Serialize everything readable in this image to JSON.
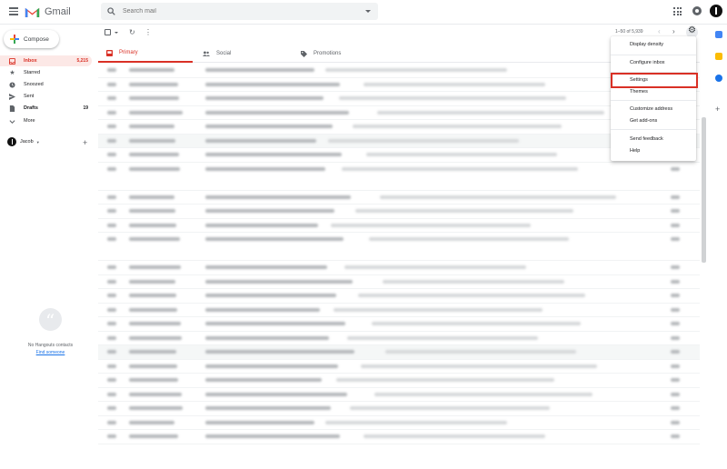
{
  "header": {
    "app_name": "Gmail",
    "search_placeholder": "Search mail"
  },
  "sidebar": {
    "compose_label": "Compose",
    "items": [
      {
        "label": "Inbox",
        "count": "5,215",
        "icon": "inbox-icon",
        "active": true
      },
      {
        "label": "Starred",
        "count": "",
        "icon": "star-icon"
      },
      {
        "label": "Snoozed",
        "count": "",
        "icon": "clock-icon"
      },
      {
        "label": "Sent",
        "count": "",
        "icon": "send-icon"
      },
      {
        "label": "Drafts",
        "count": "19",
        "icon": "draft-icon"
      },
      {
        "label": "More",
        "count": "",
        "icon": "chevron-down-icon"
      }
    ],
    "user_name": "Jacob",
    "hangouts_empty": "No Hangouts contacts",
    "hangouts_link": "Find someone"
  },
  "toolbar": {
    "pager_text": "1–50 of 5,939"
  },
  "tabs": [
    {
      "label": "Primary",
      "icon": "inbox-icon"
    },
    {
      "label": "Social",
      "icon": "people-icon"
    },
    {
      "label": "Promotions",
      "icon": "tag-icon"
    }
  ],
  "settings_menu": {
    "items": [
      "Display density",
      "Configure inbox",
      "Settings",
      "Themes",
      "Customize address",
      "Get add-ons",
      "Send feedback",
      "Help"
    ],
    "highlighted": "Settings"
  },
  "colors": {
    "accent_red": "#d93025",
    "active_bg": "#fce8e6",
    "link_blue": "#1a73e8"
  }
}
